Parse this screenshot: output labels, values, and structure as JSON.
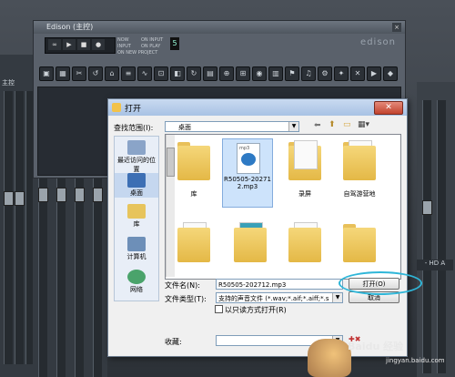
{
  "edison": {
    "title": "Edison (主控)",
    "logo": "edison",
    "counter": "5",
    "radios": [
      "NOW",
      "INPUT",
      "ON INPUT",
      "ON PLAY",
      "ON NEW PROJECT"
    ]
  },
  "mixer": {
    "left_label": "主控",
    "right_label": "- HD A"
  },
  "dialog": {
    "title": "打开",
    "close_label": "✕",
    "lookin_label": "查找范围(I):",
    "lookin_value": "桌面",
    "places": [
      {
        "label": "最近访问的位置"
      },
      {
        "label": "桌面"
      },
      {
        "label": "库"
      },
      {
        "label": "计算机"
      },
      {
        "label": "网络"
      }
    ],
    "files": [
      {
        "name": "",
        "kind": "folder"
      },
      {
        "name": "R50505-202712.mp3",
        "kind": "mp3",
        "selected": true
      },
      {
        "name": "",
        "kind": "folder"
      },
      {
        "name": "",
        "kind": "folder"
      },
      {
        "name": "库",
        "kind": "folder"
      },
      {
        "name": "",
        "kind": "folder"
      },
      {
        "name": "录屏",
        "kind": "folder"
      },
      {
        "name": "自驾游营地",
        "kind": "folder"
      }
    ],
    "filename_label": "文件名(N):",
    "filename_value": "R50505-202712.mp3",
    "filetype_label": "文件类型(T):",
    "filetype_value": "支持的声音文件 (*.wav;*.aif;*.aiff;*.s",
    "readonly_label": "以只读方式打开(R)",
    "open_button": "打开(O)",
    "cancel_button": "取消",
    "favorites_label": "收藏:"
  },
  "watermark": {
    "main": "Baidu 经验",
    "sub": "jingyan.baidu.com"
  }
}
